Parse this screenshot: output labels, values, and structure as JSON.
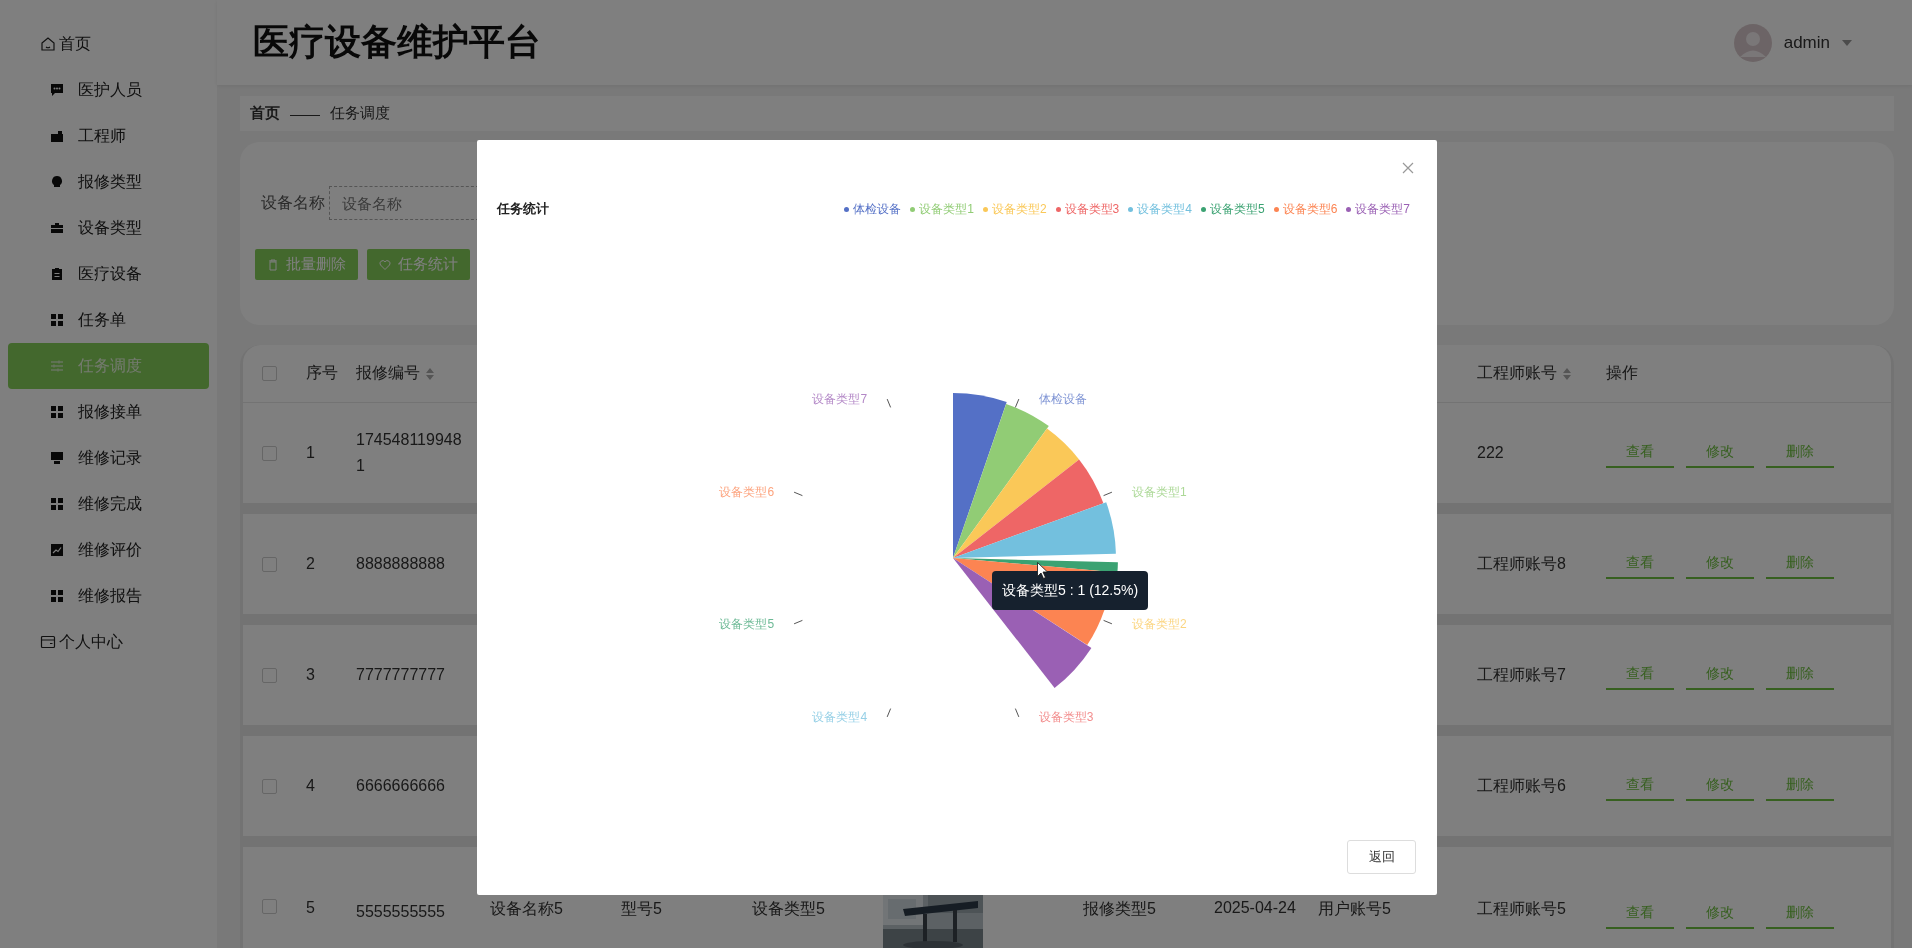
{
  "header": {
    "title": "医疗设备维护平台",
    "user": "admin"
  },
  "sidebar": {
    "items": [
      {
        "label": "首页",
        "kind": "top",
        "selected": false
      },
      {
        "label": "医护人员",
        "kind": "sub",
        "selected": false
      },
      {
        "label": "工程师",
        "kind": "sub",
        "selected": false
      },
      {
        "label": "报修类型",
        "kind": "sub",
        "selected": false
      },
      {
        "label": "设备类型",
        "kind": "sub",
        "selected": false
      },
      {
        "label": "医疗设备",
        "kind": "sub",
        "selected": false
      },
      {
        "label": "任务单",
        "kind": "sub",
        "selected": false
      },
      {
        "label": "任务调度",
        "kind": "sub",
        "selected": true
      },
      {
        "label": "报修接单",
        "kind": "sub",
        "selected": false
      },
      {
        "label": "维修记录",
        "kind": "sub",
        "selected": false
      },
      {
        "label": "维修完成",
        "kind": "sub",
        "selected": false
      },
      {
        "label": "维修评价",
        "kind": "sub",
        "selected": false
      },
      {
        "label": "维修报告",
        "kind": "sub",
        "selected": false
      },
      {
        "label": "个人中心",
        "kind": "top",
        "selected": false
      }
    ]
  },
  "breadcrumb": {
    "home": "首页",
    "separator": "——",
    "current": "任务调度"
  },
  "search": {
    "label": "设备名称",
    "placeholder": "设备名称",
    "buttons": [
      {
        "label": "批量删除",
        "kind": "delete"
      },
      {
        "label": "任务统计",
        "kind": "stats"
      }
    ]
  },
  "table": {
    "select_all_checked": false,
    "columns": [
      {
        "label": "序号",
        "sortable": false
      },
      {
        "label": "报修编号",
        "sortable": true
      },
      {
        "label": "工程师账号",
        "sortable": true
      },
      {
        "label": "操作",
        "sortable": false
      }
    ],
    "rows": [
      {
        "checked": false,
        "index": "1",
        "number": "1745481199481",
        "engineer": "222",
        "actions": [
          "查看",
          "修改",
          "删除"
        ]
      },
      {
        "checked": false,
        "index": "2",
        "number": "8888888888",
        "engineer": "工程师账号8",
        "actions": [
          "查看",
          "修改",
          "删除"
        ]
      },
      {
        "checked": false,
        "index": "3",
        "number": "7777777777",
        "engineer": "工程师账号7",
        "actions": [
          "查看",
          "修改",
          "删除"
        ]
      },
      {
        "checked": false,
        "index": "4",
        "number": "6666666666",
        "engineer": "工程师账号6",
        "actions": [
          "查看",
          "修改",
          "删除"
        ]
      },
      {
        "checked": false,
        "index": "5",
        "number": "5555555555",
        "device_name": "设备名称5",
        "model": "型号5",
        "device_type": "设备类型5",
        "image": {
          "kind": "picture"
        },
        "repair_type": "报修类型5",
        "date": "2025-04-24",
        "user_account": "用户账号5",
        "engineer": "工程师账号5",
        "actions": [
          "查看",
          "修改",
          "删除"
        ]
      }
    ]
  },
  "modal": {
    "title": "任务统计",
    "chart": {
      "legend": [
        {
          "label": "体检设备",
          "color": "#5470c6"
        },
        {
          "label": "设备类型1",
          "color": "#91cc75"
        },
        {
          "label": "设备类型2",
          "color": "#fac858"
        },
        {
          "label": "设备类型3",
          "color": "#ee6666"
        },
        {
          "label": "设备类型4",
          "color": "#73c0de"
        },
        {
          "label": "设备类型5",
          "color": "#3ba272"
        },
        {
          "label": "设备类型6",
          "color": "#fc8452"
        },
        {
          "label": "设备类型7",
          "color": "#9a60b4"
        }
      ],
      "slice_labels": [
        "体检设备",
        "设备类型1",
        "设备类型2",
        "设备类型3",
        "设备类型4",
        "设备类型5",
        "设备类型6",
        "设备类型7"
      ],
      "tooltip": "设备类型5 : 1 (12.5%)"
    },
    "back_button": "返回"
  }
}
